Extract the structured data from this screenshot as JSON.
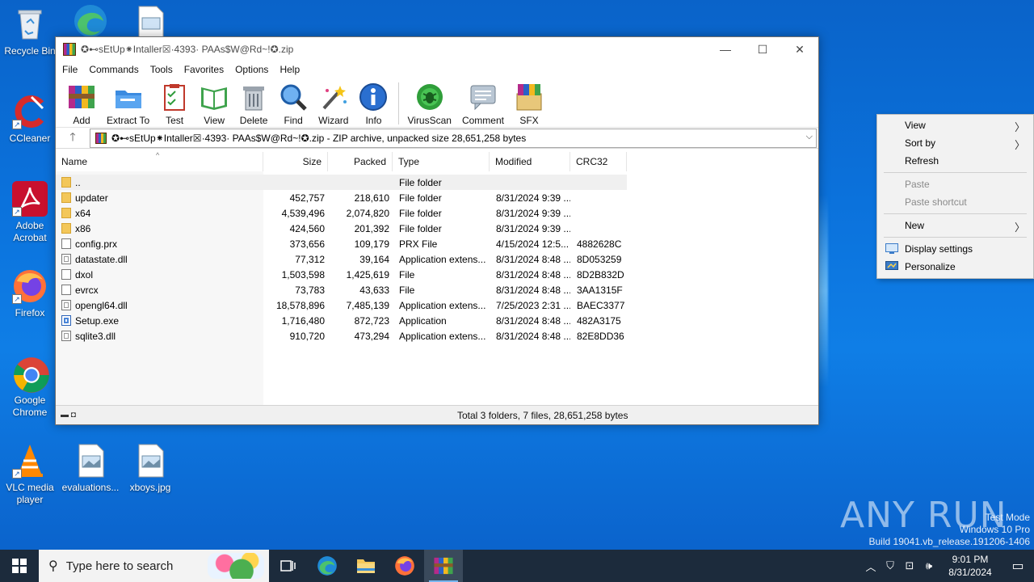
{
  "desktop": {
    "icons": [
      {
        "label": "Recycle Bin"
      },
      {
        "label": "CCleaner"
      },
      {
        "label": "Adobe Acrobat"
      },
      {
        "label": "Firefox"
      },
      {
        "label": "Google Chrome"
      },
      {
        "label": "VLC media player"
      },
      {
        "label": "evaluations..."
      },
      {
        "label": "xboys.jpg"
      }
    ]
  },
  "window": {
    "title": "✪⊷sEtUp⁕Intaller☒·4393· PAAs$W@Rd~!✪.zip",
    "controls": {
      "minimize": "—",
      "maximize": "☐",
      "close": "✕"
    },
    "menu": [
      "File",
      "Commands",
      "Tools",
      "Favorites",
      "Options",
      "Help"
    ],
    "toolbar": [
      {
        "label": "Add",
        "icon": "add-icon"
      },
      {
        "label": "Extract To",
        "icon": "extract-icon"
      },
      {
        "label": "Test",
        "icon": "test-icon"
      },
      {
        "label": "View",
        "icon": "view-icon"
      },
      {
        "label": "Delete",
        "icon": "delete-icon"
      },
      {
        "label": "Find",
        "icon": "find-icon"
      },
      {
        "label": "Wizard",
        "icon": "wizard-icon"
      },
      {
        "label": "Info",
        "icon": "info-icon"
      },
      {
        "label": "VirusScan",
        "icon": "virusscan-icon"
      },
      {
        "label": "Comment",
        "icon": "comment-icon"
      },
      {
        "label": "SFX",
        "icon": "sfx-icon"
      }
    ],
    "address": "✪⊷sEtUp⁕Intaller☒·4393· PAAs$W@Rd~!✪.zip - ZIP archive, unpacked size 28,651,258 bytes",
    "columns": [
      "Name",
      "Size",
      "Packed",
      "Type",
      "Modified",
      "CRC32"
    ],
    "files": [
      {
        "name": "..",
        "size": "",
        "packed": "",
        "type": "File folder",
        "modified": "",
        "crc": "",
        "kind": "folder"
      },
      {
        "name": "updater",
        "size": "452,757",
        "packed": "218,610",
        "type": "File folder",
        "modified": "8/31/2024 9:39 ...",
        "crc": "",
        "kind": "folder"
      },
      {
        "name": "x64",
        "size": "4,539,496",
        "packed": "2,074,820",
        "type": "File folder",
        "modified": "8/31/2024 9:39 ...",
        "crc": "",
        "kind": "folder"
      },
      {
        "name": "x86",
        "size": "424,560",
        "packed": "201,392",
        "type": "File folder",
        "modified": "8/31/2024 9:39 ...",
        "crc": "",
        "kind": "folder"
      },
      {
        "name": "config.prx",
        "size": "373,656",
        "packed": "109,179",
        "type": "PRX File",
        "modified": "4/15/2024 12:5...",
        "crc": "4882628C",
        "kind": "file"
      },
      {
        "name": "datastate.dll",
        "size": "77,312",
        "packed": "39,164",
        "type": "Application extens...",
        "modified": "8/31/2024 8:48 ...",
        "crc": "8D053259",
        "kind": "dll"
      },
      {
        "name": "dxol",
        "size": "1,503,598",
        "packed": "1,425,619",
        "type": "File",
        "modified": "8/31/2024 8:48 ...",
        "crc": "8D2B832D",
        "kind": "file"
      },
      {
        "name": "evrcx",
        "size": "73,783",
        "packed": "43,633",
        "type": "File",
        "modified": "8/31/2024 8:48 ...",
        "crc": "3AA1315F",
        "kind": "file"
      },
      {
        "name": "opengl64.dll",
        "size": "18,578,896",
        "packed": "7,485,139",
        "type": "Application extens...",
        "modified": "7/25/2023 2:31 ...",
        "crc": "BAEC3377",
        "kind": "dll"
      },
      {
        "name": "Setup.exe",
        "size": "1,716,480",
        "packed": "872,723",
        "type": "Application",
        "modified": "8/31/2024 8:48 ...",
        "crc": "482A3175",
        "kind": "exe"
      },
      {
        "name": "sqlite3.dll",
        "size": "910,720",
        "packed": "473,294",
        "type": "Application extens...",
        "modified": "8/31/2024 8:48 ...",
        "crc": "82E8DD36",
        "kind": "dll"
      }
    ],
    "status": "Total 3 folders, 7 files, 28,651,258 bytes"
  },
  "context_menu": {
    "items": [
      {
        "label": "View",
        "submenu": true,
        "disabled": false
      },
      {
        "label": "Sort by",
        "submenu": true,
        "disabled": false
      },
      {
        "label": "Refresh",
        "submenu": false,
        "disabled": false
      },
      {
        "label": "Paste",
        "submenu": false,
        "disabled": true
      },
      {
        "label": "Paste shortcut",
        "submenu": false,
        "disabled": true
      },
      {
        "label": "New",
        "submenu": true,
        "disabled": false
      },
      {
        "label": "Display settings",
        "submenu": false,
        "disabled": false
      },
      {
        "label": "Personalize",
        "submenu": false,
        "disabled": false
      }
    ]
  },
  "watermark": {
    "logo": "ANY RUN",
    "line1": "Test Mode",
    "line2": "Windows 10 Pro",
    "line3": "Build 19041.vb_release.191206-1406"
  },
  "taskbar": {
    "search_placeholder": "Type here to search",
    "time": "9:01 PM",
    "date": "8/31/2024"
  },
  "colors": {
    "accent": "#0a63c9",
    "taskbar": "#1c2b3c"
  }
}
